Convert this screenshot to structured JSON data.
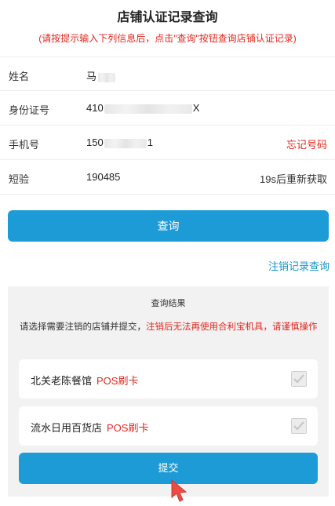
{
  "header": {
    "title": "店铺认证记录查询",
    "subtitle": "(请按提示输入下列信息后，点击\"查询\"按钮查询店铺认证记录)"
  },
  "form": {
    "name": {
      "label": "姓名",
      "value": "马"
    },
    "id_card": {
      "label": "身份证号",
      "value_prefix": "410",
      "value_suffix": "X"
    },
    "phone": {
      "label": "手机号",
      "value_prefix": "150",
      "value_suffix": "1",
      "action": "忘记号码"
    },
    "sms": {
      "label": "短验",
      "value": "190485",
      "countdown": "19s后重新获取"
    }
  },
  "query_button": "查询",
  "cancel_link": "注销记录查询",
  "results": {
    "title": "查询结果",
    "notice_plain": "请选择需要注销的店铺并提交，",
    "notice_warn": "注销后无法再使用合利宝机具，请谨慎操作",
    "items": [
      {
        "shop": "北关老陈餐馆",
        "type": "POS刷卡"
      },
      {
        "shop": "流水日用百货店",
        "type": "POS刷卡"
      }
    ],
    "submit": "提交"
  },
  "colors": {
    "accent": "#1d9bd7",
    "warning": "#e0281e",
    "link": "#1a93c8"
  }
}
